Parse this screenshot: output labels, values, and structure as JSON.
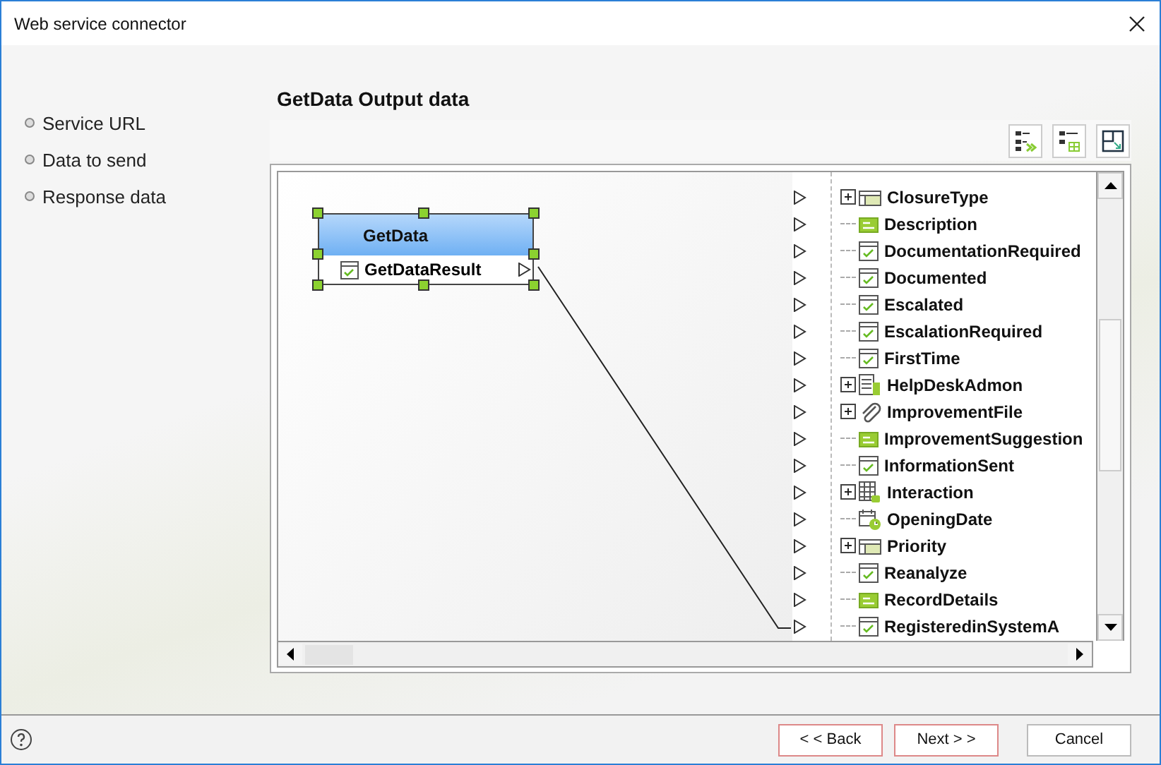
{
  "window": {
    "title": "Web service connector"
  },
  "sidebar": {
    "items": [
      {
        "label": "Service URL"
      },
      {
        "label": "Data to send"
      },
      {
        "label": "Response data"
      }
    ]
  },
  "heading": "GetData Output data",
  "node": {
    "title": "GetData",
    "selected": true,
    "field": "GetDataResult"
  },
  "tree": [
    {
      "label": "ClosureType",
      "kind": "table",
      "expandable": true
    },
    {
      "label": "Description",
      "kind": "text",
      "expandable": false
    },
    {
      "label": "DocumentationRequired",
      "kind": "boolean",
      "expandable": false
    },
    {
      "label": "Documented",
      "kind": "boolean",
      "expandable": false
    },
    {
      "label": "Escalated",
      "kind": "boolean",
      "expandable": false
    },
    {
      "label": "EscalationRequired",
      "kind": "boolean",
      "expandable": false
    },
    {
      "label": "FirstTime",
      "kind": "boolean",
      "expandable": false
    },
    {
      "label": "HelpDeskAdmon",
      "kind": "entity",
      "expandable": true
    },
    {
      "label": "ImprovementFile",
      "kind": "file",
      "expandable": true
    },
    {
      "label": "ImprovementSuggestion",
      "kind": "text",
      "expandable": false
    },
    {
      "label": "InformationSent",
      "kind": "boolean",
      "expandable": false
    },
    {
      "label": "Interaction",
      "kind": "grid",
      "expandable": true
    },
    {
      "label": "OpeningDate",
      "kind": "date",
      "expandable": false
    },
    {
      "label": "Priority",
      "kind": "table",
      "expandable": true
    },
    {
      "label": "Reanalyze",
      "kind": "boolean",
      "expandable": false
    },
    {
      "label": "RecordDetails",
      "kind": "text",
      "expandable": false
    },
    {
      "label": "RegisteredinSystemA",
      "kind": "boolean",
      "expandable": false
    }
  ],
  "buttons": [
    {
      "label": "< < Back",
      "kind": "back"
    },
    {
      "label": "Next > >",
      "kind": "next"
    },
    {
      "label": "Cancel",
      "kind": "cancel"
    }
  ]
}
